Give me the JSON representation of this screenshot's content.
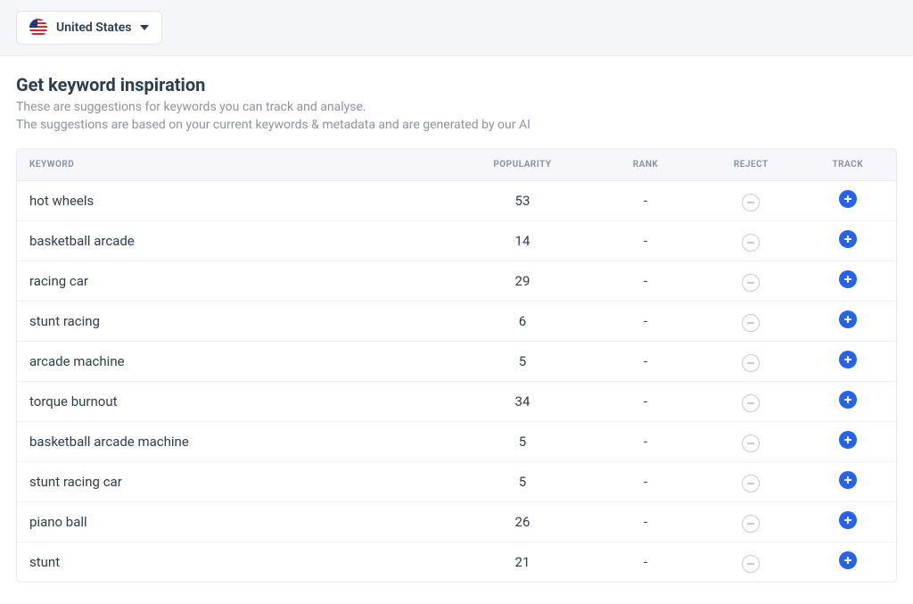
{
  "header": {
    "country_label": "United States"
  },
  "page": {
    "title": "Get keyword inspiration",
    "subtitle_line1": "These are suggestions for keywords you can track and analyse.",
    "subtitle_line2": "The suggestions are based on your current keywords & metadata and are generated by our AI"
  },
  "table": {
    "columns": {
      "keyword": "KEYWORD",
      "popularity": "POPULARITY",
      "rank": "RANK",
      "reject": "REJECT",
      "track": "TRACK"
    },
    "rows": [
      {
        "keyword": "hot wheels",
        "popularity": "53",
        "rank": "-"
      },
      {
        "keyword": "basketball arcade",
        "popularity": "14",
        "rank": "-"
      },
      {
        "keyword": "racing car",
        "popularity": "29",
        "rank": "-"
      },
      {
        "keyword": "stunt racing",
        "popularity": "6",
        "rank": "-"
      },
      {
        "keyword": "arcade machine",
        "popularity": "5",
        "rank": "-"
      },
      {
        "keyword": "torque burnout",
        "popularity": "34",
        "rank": "-"
      },
      {
        "keyword": "basketball arcade machine",
        "popularity": "5",
        "rank": "-"
      },
      {
        "keyword": "stunt racing car",
        "popularity": "5",
        "rank": "-"
      },
      {
        "keyword": "piano ball",
        "popularity": "26",
        "rank": "-"
      },
      {
        "keyword": "stunt",
        "popularity": "21",
        "rank": "-"
      }
    ]
  }
}
